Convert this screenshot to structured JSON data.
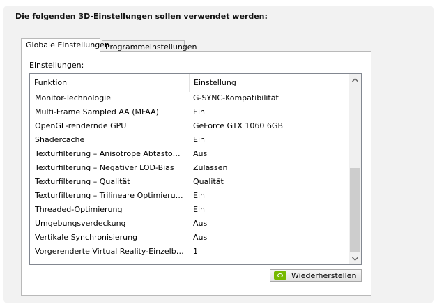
{
  "heading": "Die folgenden 3D-Einstellungen sollen verwendet werden:",
  "tabs": [
    {
      "label": "Globale Einstellungen",
      "active": true
    },
    {
      "label": "Programmeinstellungen",
      "active": false
    }
  ],
  "settings_label": "Einstellungen:",
  "columns": {
    "function": "Funktion",
    "setting": "Einstellung"
  },
  "rows": [
    {
      "function": "Monitor-Technologie",
      "setting": "G-SYNC-Kompatibilität"
    },
    {
      "function": "Multi-Frame Sampled AA (MFAA)",
      "setting": "Ein"
    },
    {
      "function": "OpenGL-rendernde GPU",
      "setting": "GeForce GTX 1060 6GB"
    },
    {
      "function": "Shadercache",
      "setting": "Ein"
    },
    {
      "function": "Texturfilterung – Anisotrope Abtastoptimi...",
      "setting": "Aus"
    },
    {
      "function": "Texturfilterung – Negativer LOD-Bias",
      "setting": "Zulassen"
    },
    {
      "function": "Texturfilterung – Qualität",
      "setting": "Qualität"
    },
    {
      "function": "Texturfilterung – Trilineare Optimierung",
      "setting": "Ein"
    },
    {
      "function": "Threaded-Optimierung",
      "setting": "Ein"
    },
    {
      "function": "Umgebungsverdeckung",
      "setting": "Aus"
    },
    {
      "function": "Vertikale Synchronisierung",
      "setting": "Aus"
    },
    {
      "function": "Vorgerenderte Virtual Reality-Einzelbilder",
      "setting": "1"
    }
  ],
  "restore_button": "Wiederherstellen",
  "icons": {
    "scroll_up": "chevron-up-icon",
    "scroll_down": "chevron-down-icon",
    "restore": "nvidia-logo-icon"
  },
  "colors": {
    "nvidia_green": "#76b900"
  }
}
